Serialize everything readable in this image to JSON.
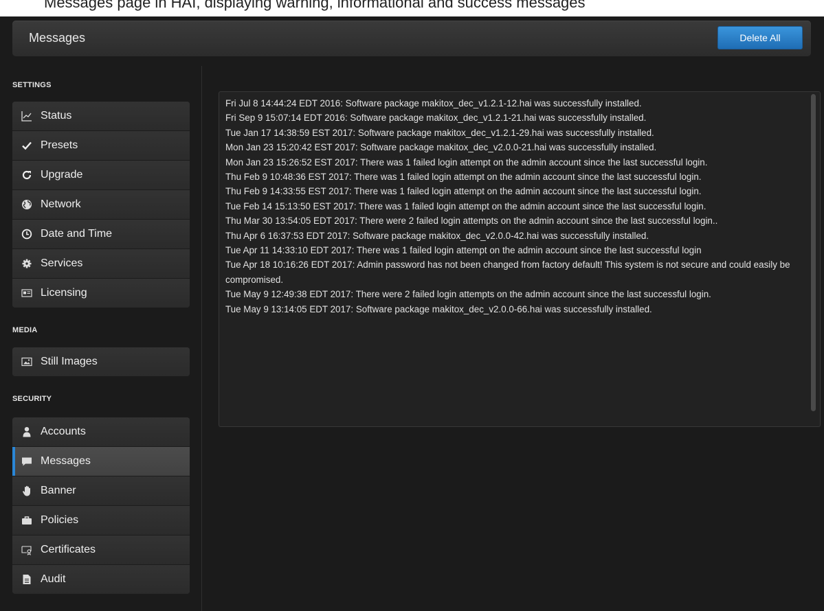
{
  "caption": "Messages page in HAI, displaying warning, informational and success messages",
  "header": {
    "title": "Messages",
    "delete_all_label": "Delete All"
  },
  "sidebar": {
    "settings": {
      "label": "SETTINGS",
      "items": [
        {
          "label": "Status",
          "icon": "chart-icon"
        },
        {
          "label": "Presets",
          "icon": "checkmark-icon"
        },
        {
          "label": "Upgrade",
          "icon": "refresh-icon"
        },
        {
          "label": "Network",
          "icon": "globe-icon"
        },
        {
          "label": "Date and Time",
          "icon": "clock-icon"
        },
        {
          "label": "Services",
          "icon": "gear-icon"
        },
        {
          "label": "Licensing",
          "icon": "license-card-icon"
        }
      ]
    },
    "media": {
      "label": "MEDIA",
      "items": [
        {
          "label": "Still Images",
          "icon": "image-icon"
        }
      ]
    },
    "security": {
      "label": "SECURITY",
      "items": [
        {
          "label": "Accounts",
          "icon": "user-icon"
        },
        {
          "label": "Messages",
          "icon": "message-icon",
          "active": true
        },
        {
          "label": "Banner",
          "icon": "hand-icon"
        },
        {
          "label": "Policies",
          "icon": "briefcase-icon"
        },
        {
          "label": "Certificates",
          "icon": "certificate-icon"
        },
        {
          "label": "Audit",
          "icon": "document-icon"
        }
      ]
    }
  },
  "messages": [
    "Fri Jul 8 14:44:24 EDT 2016: Software package makitox_dec_v1.2.1-12.hai was successfully installed.",
    "Fri Sep 9 15:07:14 EDT 2016: Software package makitox_dec_v1.2.1-21.hai was successfully installed.",
    "Tue Jan 17 14:38:59 EST 2017: Software package makitox_dec_v1.2.1-29.hai was successfully installed.",
    "Mon Jan 23 15:20:42 EST 2017: Software package makitox_dec_v2.0.0-21.hai was successfully installed.",
    "Mon Jan 23 15:26:52 EST 2017: There was 1 failed login attempt on the admin account since the last successful login.",
    "Thu Feb 9 10:48:36 EST 2017: There was 1 failed login attempt on the admin account since the last successful login.",
    "Thu Feb 9 14:33:55 EST 2017: There was 1 failed login attempt on the admin account since the last successful login.",
    "Tue Feb 14 15:13:50 EST 2017: There was 1 failed login attempt on the admin account since the last successful login.",
    "Thu Mar 30 13:54:05 EDT 2017: There were 2 failed login attempts on the admin account since the last successful login..",
    "Thu Apr 6 16:37:53 EDT 2017: Software package makitox_dec_v2.0.0-42.hai was successfully installed.",
    "Tue Apr 11 14:33:10 EDT 2017: There was 1 failed login attempt on the admin account since the last successful login",
    "Tue Apr 18 10:16:26 EDT 2017: Admin password has not been changed from factory default! This system is not secure and could easily be compromised.",
    "Tue May 9 12:49:38 EDT 2017: There were 2 failed login attempts on the admin account since the last successful login.",
    "Tue May 9 13:14:05 EDT 2017: Software package makitox_dec_v2.0.0-66.hai was successfully installed."
  ]
}
